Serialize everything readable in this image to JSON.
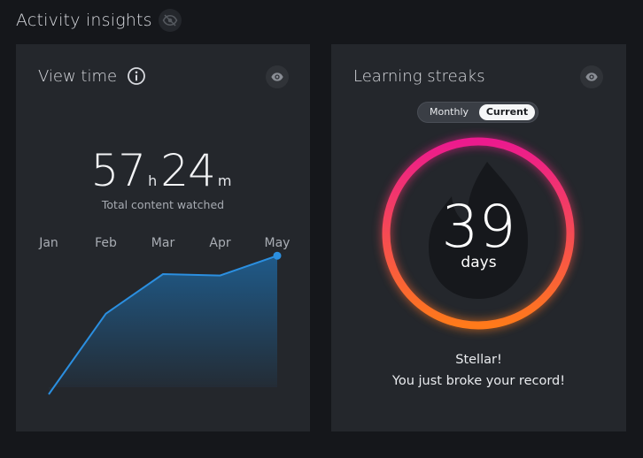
{
  "header": {
    "title": "Activity insights",
    "hide_icon": "eye-off-icon"
  },
  "view_time": {
    "title": "View time",
    "info_icon": "info-icon",
    "visibility_icon": "eye-icon",
    "hours": "57",
    "hours_unit": "h",
    "minutes": "24",
    "minutes_unit": "m",
    "subtitle": "Total content watched"
  },
  "chart_data": {
    "type": "area",
    "categories": [
      "Jan",
      "Feb",
      "Mar",
      "Apr",
      "May"
    ],
    "values": [
      0,
      0.57,
      0.85,
      0.84,
      0.98
    ],
    "ylim": [
      0,
      1
    ],
    "grid": false,
    "line_color": "#2b8fe0",
    "fill_color": "#1f5d8e",
    "highlight_last_point": true
  },
  "streaks": {
    "title": "Learning streaks",
    "visibility_icon": "eye-icon",
    "toggle": {
      "options": [
        "Monthly",
        "Current"
      ],
      "selected": "Current"
    },
    "days": "39",
    "days_label": "days",
    "background_icon": "flame-icon",
    "ring_colors": [
      "#ec1a8e",
      "#ff7a1a"
    ],
    "message_line1": "Stellar!",
    "message_line2": "You just broke your record!"
  }
}
